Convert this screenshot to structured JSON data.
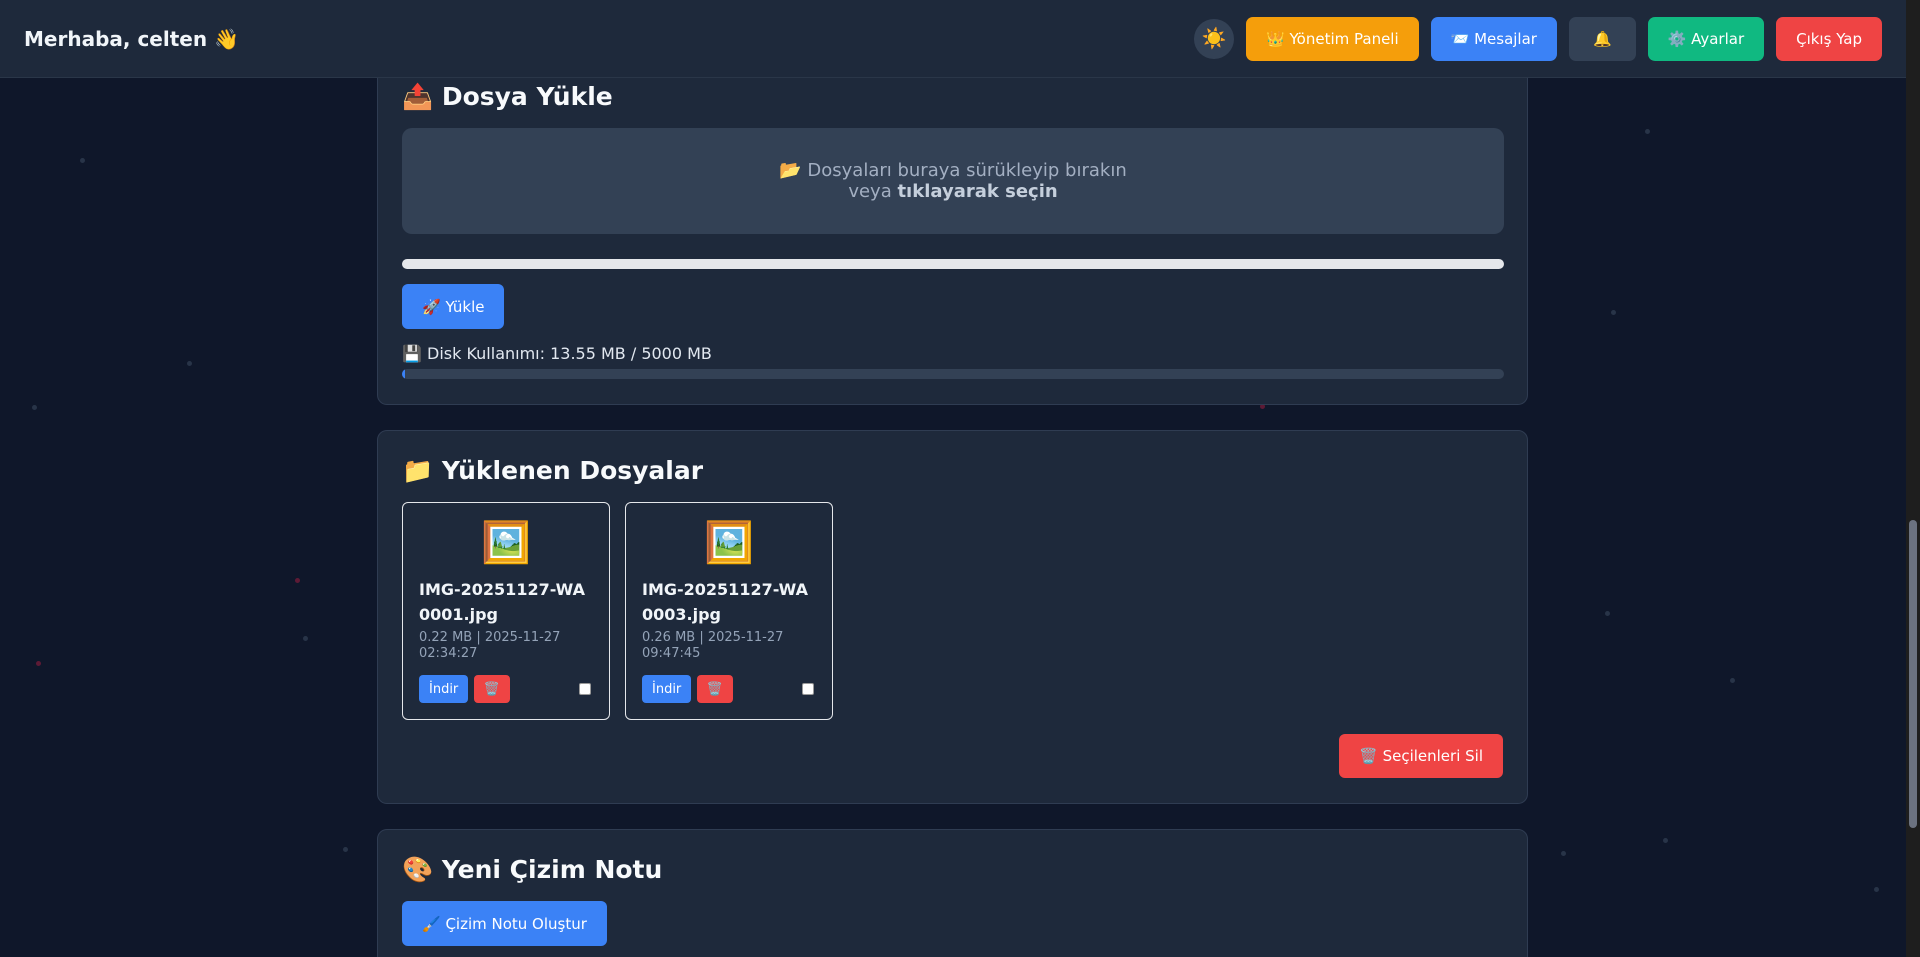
{
  "header": {
    "greeting": "Merhaba, celten 👋",
    "theme_toggle": "☀️",
    "admin_panel": "👑 Yönetim Paneli",
    "messages": "📨 Mesajlar",
    "notifications": "🔔",
    "settings": "⚙️ Ayarlar",
    "logout": "Çıkış Yap"
  },
  "upload": {
    "title": "📤 Dosya Yükle",
    "drop_line1": "📂 Dosyaları buraya sürükleyip bırakın",
    "drop_line2_prefix": "veya ",
    "drop_line2_bold": "tıklayarak seçin",
    "upload_button": "🚀 Yükle",
    "disk_usage": "💾 Disk Kullanımı: 13.55 MB / 5000 MB",
    "disk_used_fraction": 0.00271
  },
  "files": {
    "title": "📁 Yüklenen Dosyalar",
    "items": [
      {
        "icon": "🖼️",
        "name": "IMG-20251127-WA0001.jpg",
        "meta": "0.22 MB | 2025-11-27 02:34:27",
        "download_label": "İndir",
        "delete_label": "🗑️"
      },
      {
        "icon": "🖼️",
        "name": "IMG-20251127-WA0003.jpg",
        "meta": "0.26 MB | 2025-11-27 09:47:45",
        "download_label": "İndir",
        "delete_label": "🗑️"
      }
    ],
    "delete_selected": "🗑️ Seçilenleri Sil"
  },
  "drawing": {
    "title": "🎨 Yeni Çizim Notu",
    "create_button": "🖌️ Çizim Notu Oluştur"
  },
  "colors": {
    "background": "#0f172a",
    "card": "#1e293b",
    "primary": "#3b82f6",
    "danger": "#ef4444",
    "success": "#10b981",
    "warning": "#f59e0b"
  }
}
